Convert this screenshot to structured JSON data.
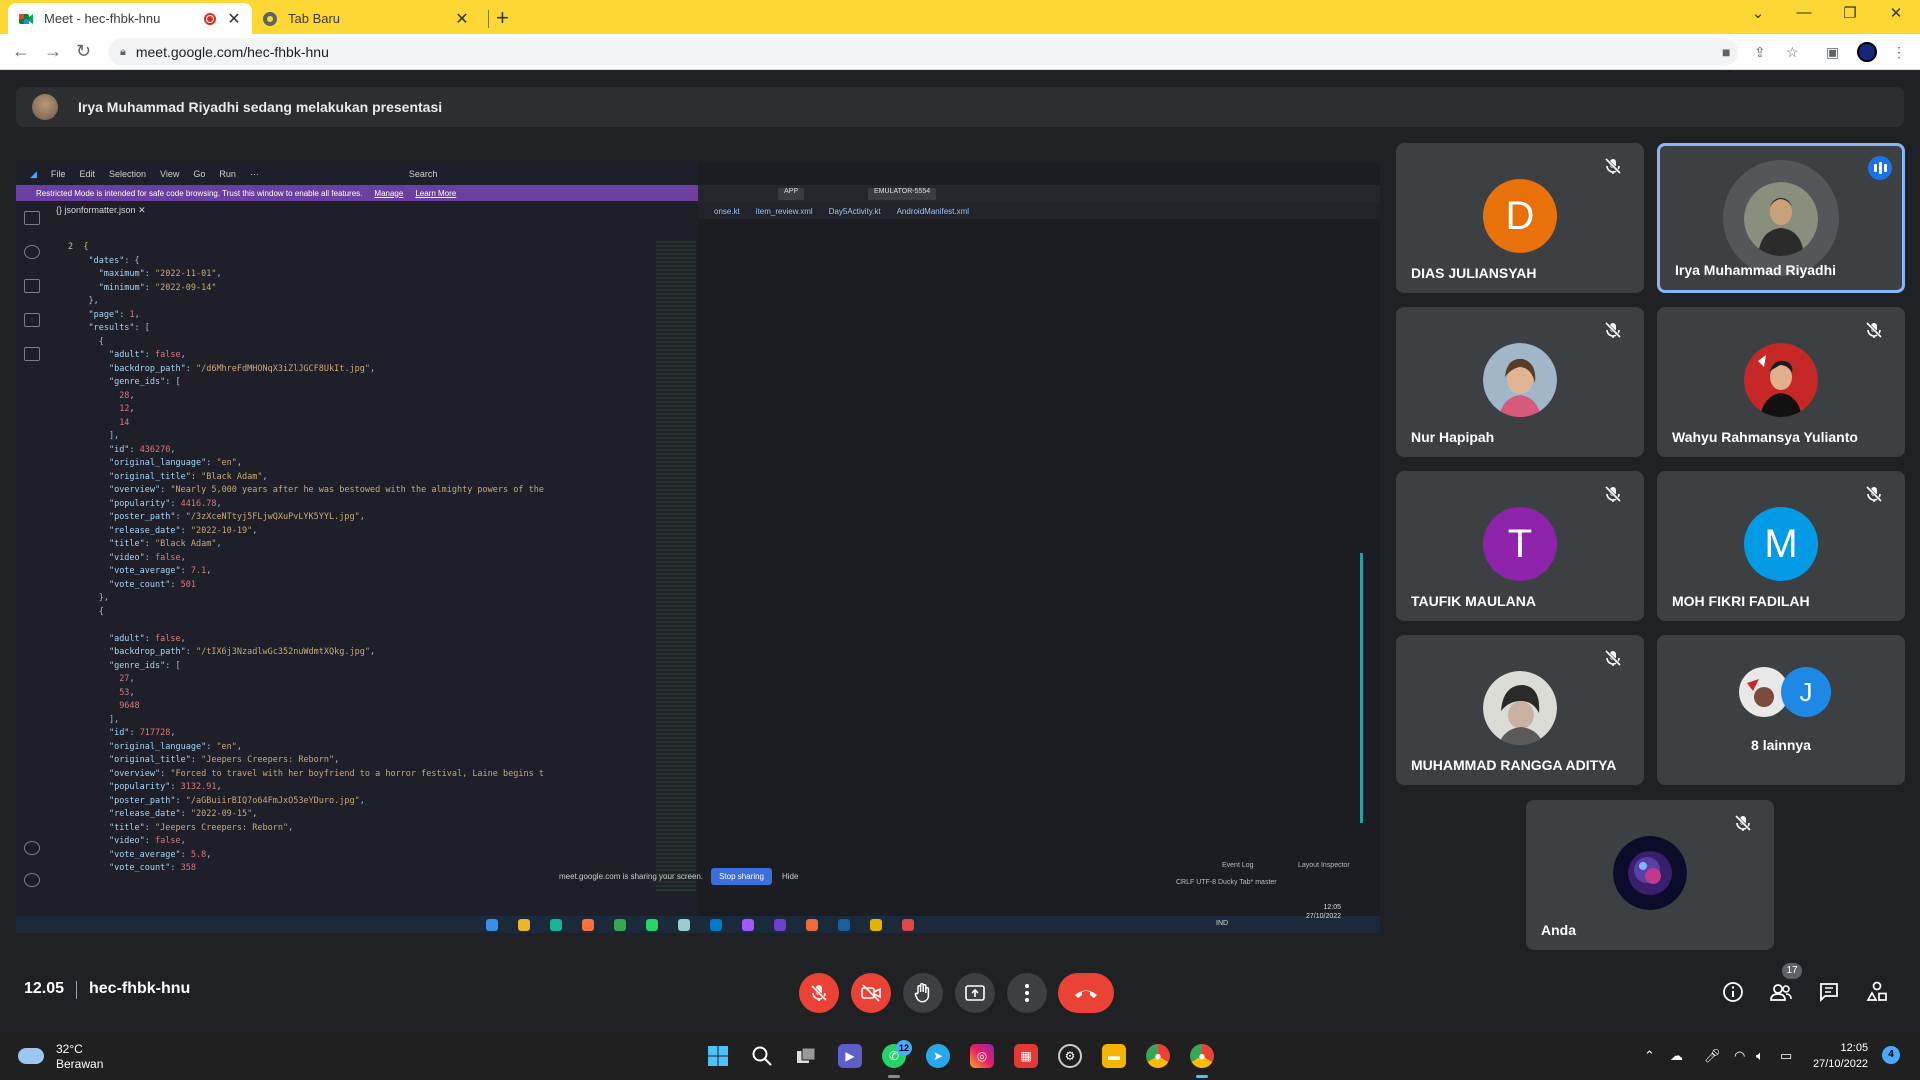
{
  "browser": {
    "tabs": [
      {
        "title": "Meet - hec-fhbk-hnu",
        "active": true
      },
      {
        "title": "Tab Baru",
        "active": false
      }
    ],
    "new_tab_symbol": "+",
    "url": "meet.google.com/hec-fhbk-hnu"
  },
  "presenter_banner": "Irya Muhammad Riyadhi sedang melakukan presentasi",
  "shared_screen": {
    "vscode_menu": [
      "File",
      "Edit",
      "Selection",
      "View",
      "Go",
      "Run",
      "···"
    ],
    "vscode_search": "Search",
    "restricted_notice": "Restricted Mode is intended for safe code browsing. Trust this window to enable all features.",
    "restricted_manage": "Manage",
    "restricted_learn": "Learn More",
    "editor_tab": "jsonformatter.json",
    "line_number": "2",
    "studio_run_config": "APP",
    "studio_device": "EMULATOR-5554",
    "studio_tabs": [
      "onse.kt",
      "item_review.xml",
      "Day5Activity.kt",
      "AndroidManifest.xml"
    ],
    "sharing_notice": "meet.google.com is sharing your screen.",
    "stop_sharing": "Stop sharing",
    "hide": "Hide",
    "studio_event_log": "Event Log",
    "studio_layout_inspector": "Layout Inspector",
    "studio_status": "CRLF  UTF-8  Ducky  Tab*  master",
    "inner_tray_lang": "IND",
    "inner_time": "12:05",
    "inner_date": "27/10/2022"
  },
  "participants": [
    {
      "name": "DIAS JULIANSYAH",
      "initial": "D",
      "color": "#e8710a",
      "muted": true
    },
    {
      "name": "Irya Muhammad Riyadhi",
      "initial": "",
      "color": "",
      "muted": false,
      "speaking": true
    },
    {
      "name": "Nur Hapipah",
      "initial": "",
      "color": "",
      "muted": true
    },
    {
      "name": "Wahyu Rahmansya Yulianto",
      "initial": "",
      "color": "",
      "muted": true
    },
    {
      "name": "TAUFIK MAULANA",
      "initial": "T",
      "color": "#8e24aa",
      "muted": true
    },
    {
      "name": "MOH FIKRI FADILAH",
      "initial": "M",
      "color": "#039be5",
      "muted": true
    },
    {
      "name": "MUHAMMAD RANGGA ADITYA",
      "initial": "",
      "color": "",
      "muted": true
    },
    {
      "name": "Anda",
      "initial": "",
      "color": "",
      "muted": true
    }
  ],
  "others": {
    "label": "8 lainnya",
    "initial": "J",
    "color": "#1e88e5"
  },
  "meet_bar": {
    "time": "12.05",
    "code": "hec-fhbk-hnu",
    "people_count": "17"
  },
  "win_taskbar": {
    "temp": "32°C",
    "weather": "Berawan",
    "whatsapp_badge": "12",
    "time": "12:05",
    "date": "27/10/2022",
    "notifications": "4"
  }
}
